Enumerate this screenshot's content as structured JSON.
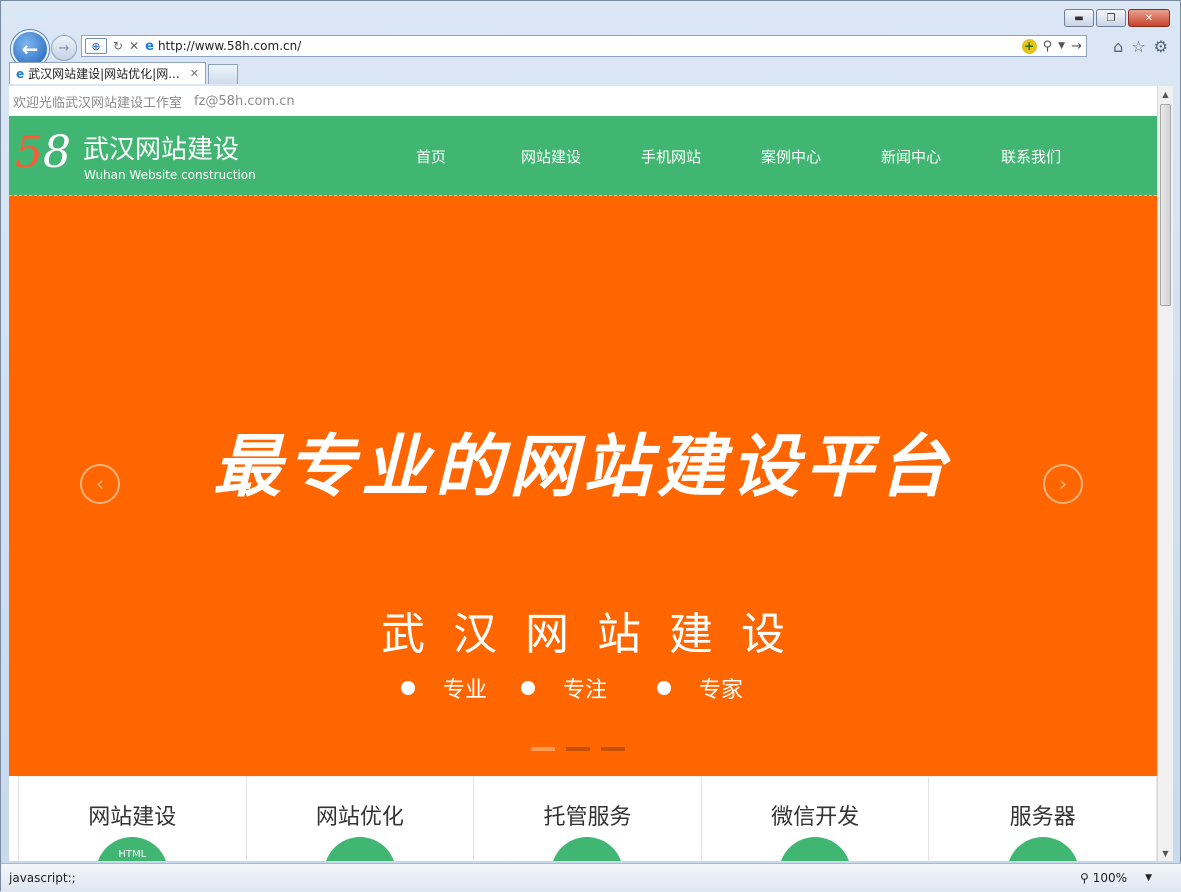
{
  "browser": {
    "url": "http://www.58h.com.cn/",
    "tab_title": "武汉网站建设|网站优化|网...",
    "tab_close": "✕",
    "status": "javascript:;",
    "zoom": "100%",
    "win": {
      "min": "▬",
      "max": "❐",
      "close": "✕"
    }
  },
  "site": {
    "welcome": "欢迎光临武汉网站建设工作室",
    "email": "fz@58h.com.cn",
    "logo": {
      "five": "5",
      "eight": "8",
      "title": "武汉网站建设",
      "subtitle": "Wuhan Website construction"
    },
    "menu": [
      "首页",
      "网站建设",
      "手机网站",
      "案例中心",
      "新闻中心",
      "联系我们"
    ],
    "banner": {
      "slogan": "最专业的网站建设平台",
      "subtitle": "武汉网站建设",
      "bullets": [
        "专业",
        "专注",
        "专家"
      ],
      "prev": "‹",
      "next": "›",
      "active_slide": 1
    },
    "services": [
      {
        "name": "网站建设",
        "icon_text": "HTML"
      },
      {
        "name": "网站优化",
        "icon_text": ""
      },
      {
        "name": "托管服务",
        "icon_text": ""
      },
      {
        "name": "微信开发",
        "icon_text": ""
      },
      {
        "name": "服务器",
        "icon_text": ""
      }
    ]
  },
  "colors": {
    "header_green": "#41b672",
    "banner_orange": "#ff6600"
  }
}
